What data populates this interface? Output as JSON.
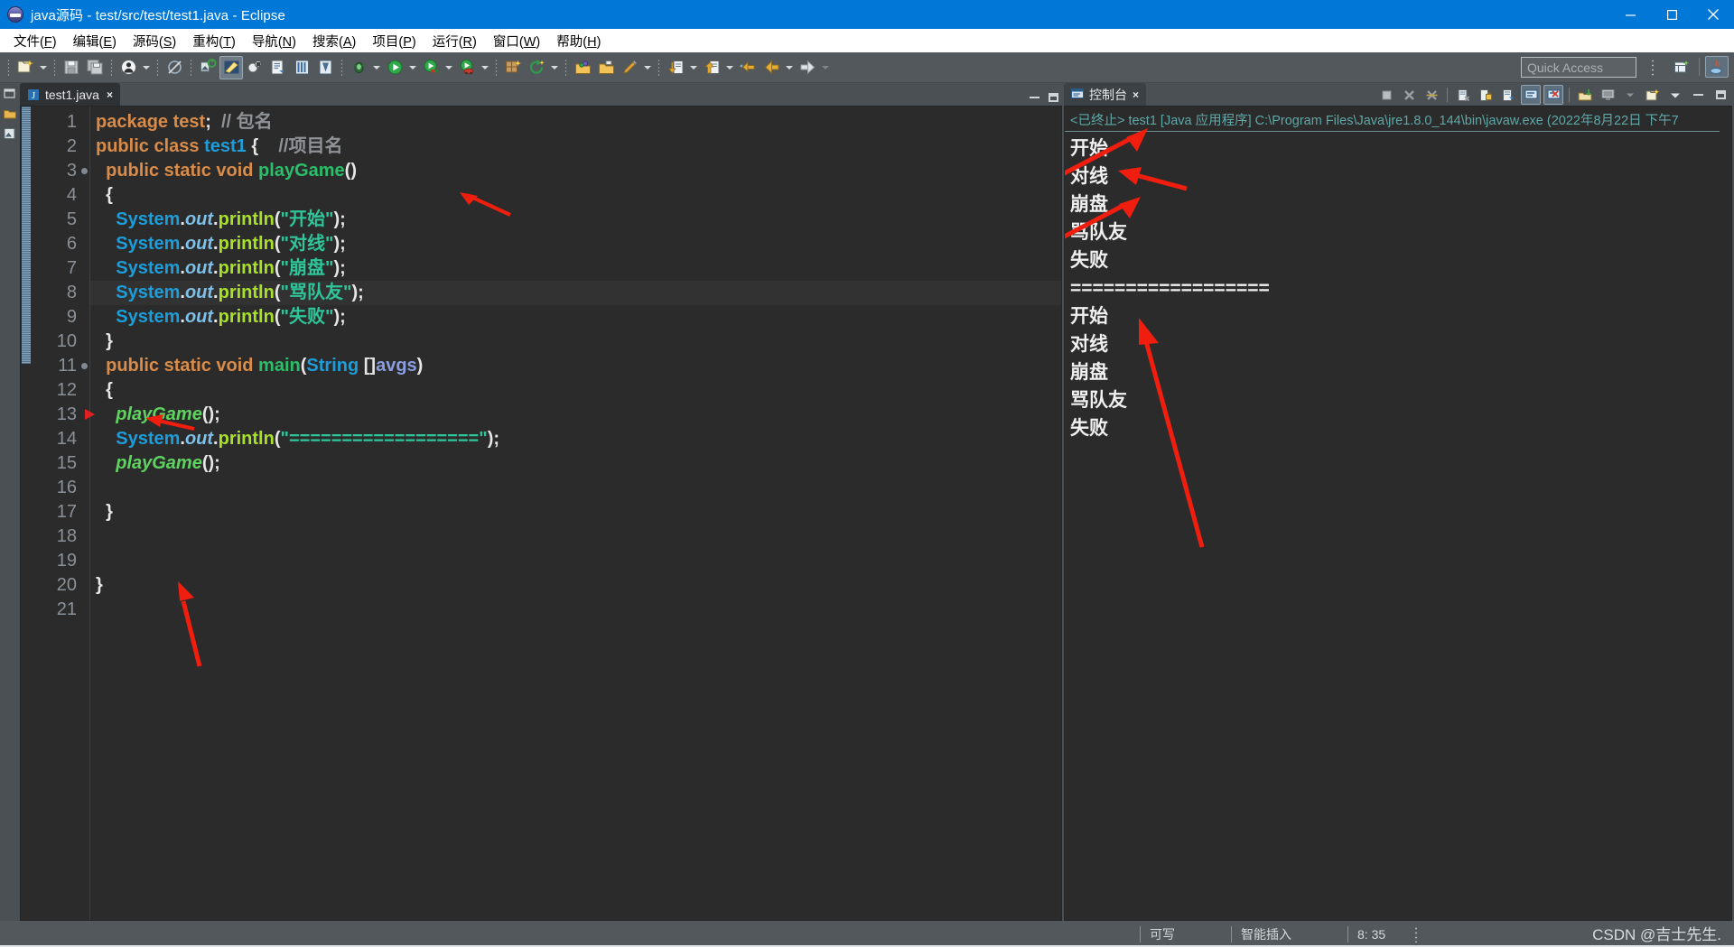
{
  "window": {
    "title": "java源码 - test/src/test/test1.java - Eclipse",
    "icon": "eclipse-icon",
    "buttons": [
      {
        "name": "minimize-button",
        "glyph": "minimize-icon"
      },
      {
        "name": "maximize-button",
        "glyph": "maximize-icon"
      },
      {
        "name": "close-button",
        "glyph": "close-icon"
      }
    ]
  },
  "menubar": {
    "items": [
      {
        "label": "文件",
        "key": "F"
      },
      {
        "label": "编辑",
        "key": "E"
      },
      {
        "label": "源码",
        "key": "S"
      },
      {
        "label": "重构",
        "key": "T"
      },
      {
        "label": "导航",
        "key": "N"
      },
      {
        "label": "搜索",
        "key": "A"
      },
      {
        "label": "项目",
        "key": "P"
      },
      {
        "label": "运行",
        "key": "R"
      },
      {
        "label": "窗口",
        "key": "W"
      },
      {
        "label": "帮助",
        "key": "H"
      }
    ]
  },
  "toolbar": {
    "quick_access_placeholder": "Quick Access",
    "icons": [
      "new-wizard-icon",
      "save-icon",
      "save-all-icon",
      "print-icon",
      "toggle-markers-icon",
      "new-java-project-icon",
      "new-java-class-icon",
      "search-icon",
      "open-task-icon",
      "open-type-icon",
      "toggle-breadcrumb-icon",
      "debug-icon",
      "run-icon",
      "run-coverage-icon",
      "external-tools-icon",
      "new-package-icon",
      "refresh-icon",
      "open-perspective-icon",
      "open-folder-icon",
      "edit-icon",
      "import-icon",
      "export-icon",
      "back-icon",
      "previous-icon",
      "forward-icon"
    ],
    "perspective": {
      "open_icon": "open-perspective-icon",
      "java_icon": "java-perspective-icon"
    }
  },
  "editor": {
    "tab": {
      "label": "test1.java",
      "icon": "java-file-icon",
      "close": "×"
    },
    "min_label": "minimize-icon",
    "max_label": "maximize-icon",
    "current_line": 8,
    "breakpoint_line": 13,
    "fold_lines": [
      3,
      11
    ],
    "lines": [
      {
        "n": 1,
        "tokens": [
          [
            "kw",
            "package"
          ],
          [
            "pun",
            " "
          ],
          [
            "kw",
            "test"
          ],
          [
            "pun",
            ";"
          ],
          [
            "cmt",
            "  // 包名"
          ]
        ]
      },
      {
        "n": 2,
        "tokens": [
          [
            "kw",
            "public class "
          ],
          [
            "cls",
            "test1"
          ],
          [
            "pun",
            " {"
          ],
          [
            "cmt",
            "    //项目名"
          ]
        ]
      },
      {
        "n": 3,
        "tokens": [
          [
            "pun",
            "  "
          ],
          [
            "kw",
            "public static void "
          ],
          [
            "mth",
            "playGame"
          ],
          [
            "pun",
            "()"
          ]
        ]
      },
      {
        "n": 4,
        "tokens": [
          [
            "pun",
            "  {"
          ]
        ]
      },
      {
        "n": 5,
        "tokens": [
          [
            "pun",
            "    "
          ],
          [
            "cls",
            "System"
          ],
          [
            "pun",
            "."
          ],
          [
            "fld",
            "out"
          ],
          [
            "pun",
            "."
          ],
          [
            "prt",
            "println"
          ],
          [
            "pun",
            "("
          ],
          [
            "str",
            "\"开始\""
          ],
          [
            "pun",
            ");"
          ]
        ]
      },
      {
        "n": 6,
        "tokens": [
          [
            "pun",
            "    "
          ],
          [
            "cls",
            "System"
          ],
          [
            "pun",
            "."
          ],
          [
            "fld",
            "out"
          ],
          [
            "pun",
            "."
          ],
          [
            "prt",
            "println"
          ],
          [
            "pun",
            "("
          ],
          [
            "str",
            "\"对线\""
          ],
          [
            "pun",
            ");"
          ]
        ]
      },
      {
        "n": 7,
        "tokens": [
          [
            "pun",
            "    "
          ],
          [
            "cls",
            "System"
          ],
          [
            "pun",
            "."
          ],
          [
            "fld",
            "out"
          ],
          [
            "pun",
            "."
          ],
          [
            "prt",
            "println"
          ],
          [
            "pun",
            "("
          ],
          [
            "str",
            "\"崩盘\""
          ],
          [
            "pun",
            ");"
          ]
        ]
      },
      {
        "n": 8,
        "tokens": [
          [
            "pun",
            "    "
          ],
          [
            "cls",
            "System"
          ],
          [
            "pun",
            "."
          ],
          [
            "fld",
            "out"
          ],
          [
            "pun",
            "."
          ],
          [
            "prt",
            "println"
          ],
          [
            "pun",
            "("
          ],
          [
            "str",
            "\"骂队友\""
          ],
          [
            "pun",
            ");"
          ]
        ]
      },
      {
        "n": 9,
        "tokens": [
          [
            "pun",
            "    "
          ],
          [
            "cls",
            "System"
          ],
          [
            "pun",
            "."
          ],
          [
            "fld",
            "out"
          ],
          [
            "pun",
            "."
          ],
          [
            "prt",
            "println"
          ],
          [
            "pun",
            "("
          ],
          [
            "str",
            "\"失败\""
          ],
          [
            "pun",
            ");"
          ]
        ]
      },
      {
        "n": 10,
        "tokens": [
          [
            "pun",
            "  }"
          ]
        ]
      },
      {
        "n": 11,
        "tokens": [
          [
            "pun",
            "  "
          ],
          [
            "kw",
            "public static void "
          ],
          [
            "mth",
            "main"
          ],
          [
            "pun",
            "("
          ],
          [
            "cls",
            "String"
          ],
          [
            "pun",
            " []"
          ],
          [
            "var",
            "avgs"
          ],
          [
            "pun",
            ")"
          ]
        ]
      },
      {
        "n": 12,
        "tokens": [
          [
            "pun",
            "  {"
          ]
        ]
      },
      {
        "n": 13,
        "tokens": [
          [
            "pun",
            "    "
          ],
          [
            "mthcall",
            "playGame"
          ],
          [
            "pun",
            "();"
          ]
        ]
      },
      {
        "n": 14,
        "tokens": [
          [
            "pun",
            "    "
          ],
          [
            "cls",
            "System"
          ],
          [
            "pun",
            "."
          ],
          [
            "fld",
            "out"
          ],
          [
            "pun",
            "."
          ],
          [
            "prt",
            "println"
          ],
          [
            "pun",
            "("
          ],
          [
            "str",
            "\"==================\""
          ],
          [
            "pun",
            ");"
          ]
        ]
      },
      {
        "n": 15,
        "tokens": [
          [
            "pun",
            "    "
          ],
          [
            "mthcall",
            "playGame"
          ],
          [
            "pun",
            "();"
          ]
        ]
      },
      {
        "n": 16,
        "tokens": []
      },
      {
        "n": 17,
        "tokens": [
          [
            "pun",
            "  }"
          ]
        ]
      },
      {
        "n": 18,
        "tokens": []
      },
      {
        "n": 19,
        "tokens": []
      },
      {
        "n": 20,
        "tokens": [
          [
            "pun",
            "}"
          ]
        ]
      },
      {
        "n": 21,
        "tokens": []
      }
    ]
  },
  "console": {
    "tab": {
      "label": "控制台",
      "icon": "console-icon",
      "close": "×"
    },
    "header": "<已终止> test1 [Java 应用程序] C:\\Program Files\\Java\\jre1.8.0_144\\bin\\javaw.exe  (2022年8月22日 下午7",
    "output": [
      "开始",
      "对线",
      "崩盘",
      "骂队友",
      "失败",
      "==================",
      "开始",
      "对线",
      "崩盘",
      "骂队友",
      "失败"
    ],
    "tools": [
      "terminate-icon",
      "remove-launch-icon",
      "remove-all-terminated-icon",
      "clear-console-icon",
      "scroll-lock-icon",
      "show-console-on-output-icon",
      "pin-console-icon",
      "display-selected-console-icon",
      "open-console-icon",
      "show-console-icon",
      "new-console-view-icon",
      "minimize-icon",
      "maximize-icon"
    ]
  },
  "statusbar": {
    "writable": "可写",
    "insert_mode": "智能插入",
    "position": "8: 35",
    "watermark": "CSDN @吉士先生."
  },
  "annotations": {
    "color": "#f01e0e",
    "arrows": [
      {
        "name": "arrow-method-definition",
        "note": "points to playGame() declaration line 3"
      },
      {
        "name": "arrow-closing-brace",
        "note": "points to closing brace line 10"
      },
      {
        "name": "arrow-second-call",
        "note": "points up to playGame() call line 15"
      },
      {
        "name": "arrow-console-line1",
        "note": "points to console header region"
      },
      {
        "name": "arrow-console-duiXian",
        "note": "points to 对线 output line"
      },
      {
        "name": "arrow-console-block2",
        "note": "points to second block in console"
      },
      {
        "name": "arrow-console-long",
        "note": "long arrow pointing up to 崩盘 of block 2"
      }
    ]
  }
}
